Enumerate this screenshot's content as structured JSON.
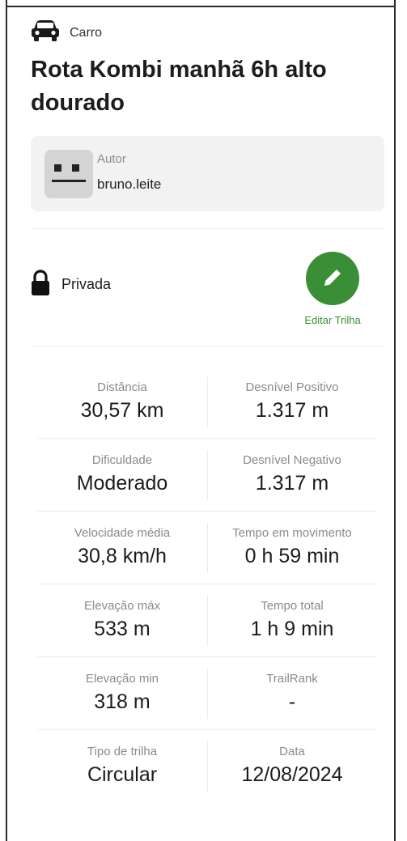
{
  "activity": {
    "icon": "car-icon",
    "label": "Carro"
  },
  "title": "Rota Kombi manhã 6h alto dourado",
  "author": {
    "label": "Autor",
    "name": "bruno.leite",
    "avatar_icon": "avatar-face-icon"
  },
  "privacy": {
    "icon": "lock-icon",
    "label": "Privada"
  },
  "edit": {
    "icon": "pencil-icon",
    "label": "Editar Trilha",
    "color": "#3a8f36"
  },
  "stats": [
    {
      "left": {
        "label": "Distância",
        "value": "30,57 km"
      },
      "right": {
        "label": "Desnível Positivo",
        "value": "1.317 m"
      }
    },
    {
      "left": {
        "label": "Dificuldade",
        "value": "Moderado"
      },
      "right": {
        "label": "Desnível Negativo",
        "value": "1.317 m"
      }
    },
    {
      "left": {
        "label": "Velocidade média",
        "value": "30,8 km/h"
      },
      "right": {
        "label": "Tempo em movimento",
        "value": "0 h 59 min"
      }
    },
    {
      "left": {
        "label": "Elevação máx",
        "value": "533 m"
      },
      "right": {
        "label": "Tempo total",
        "value": "1 h 9 min"
      }
    },
    {
      "left": {
        "label": "Elevação min",
        "value": "318 m"
      },
      "right": {
        "label": "TrailRank",
        "value": "-"
      }
    },
    {
      "left": {
        "label": "Tipo de trilha",
        "value": "Circular"
      },
      "right": {
        "label": "Data",
        "value": "12/08/2024"
      }
    }
  ]
}
